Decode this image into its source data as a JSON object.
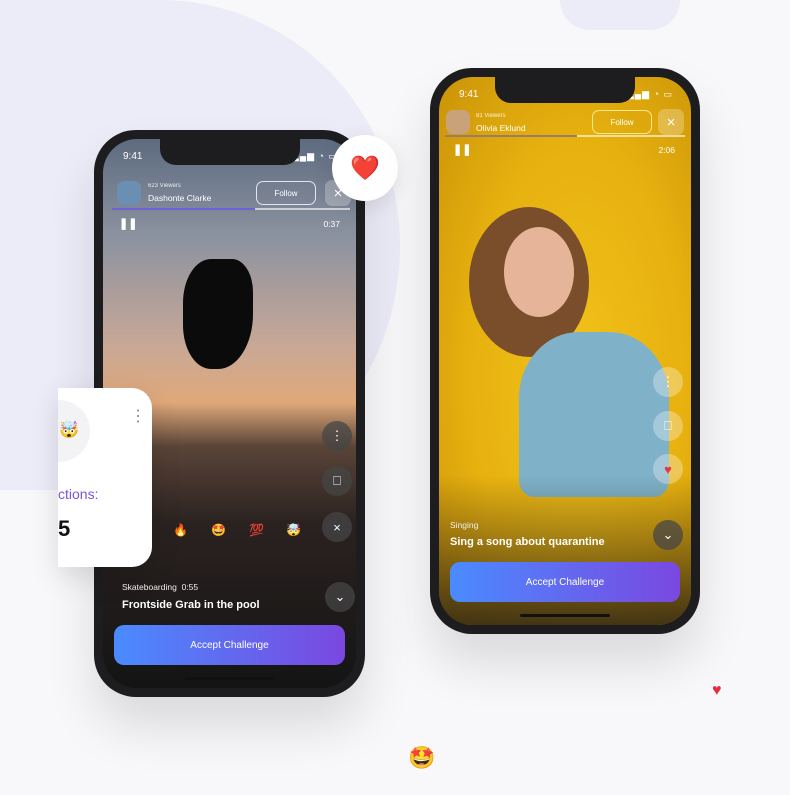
{
  "status_time": "9:41",
  "left_phone": {
    "viewers": "623 Viewers",
    "name": "Dashonte Clarke",
    "follow": "Follow",
    "duration": "0:37",
    "progress": 0.6,
    "category": "Skateboarding",
    "cat_time": "0:55",
    "title": "Frontside Grab in the pool",
    "cta": "Accept Challenge",
    "reactions": [
      "🔥",
      "🤩",
      "💯",
      "🤯"
    ]
  },
  "right_phone": {
    "viewers": "81 Viewers",
    "name": "Olivia Eklund",
    "follow": "Follow",
    "duration": "2:06",
    "progress": 0.55,
    "category": "Singing",
    "title": "Sing a song about quarantine",
    "cta": "Accept Challenge"
  },
  "reactions_card": {
    "label": "ctions:",
    "count": "5",
    "emoji": "🤯"
  },
  "floating": {
    "heart": "❤️",
    "emoji": "🤩"
  },
  "colors": {
    "accent_start": "#4a8bff",
    "accent_end": "#7a48e0",
    "card_label": "#7b52e0",
    "right_bg": "#e7b10f"
  }
}
